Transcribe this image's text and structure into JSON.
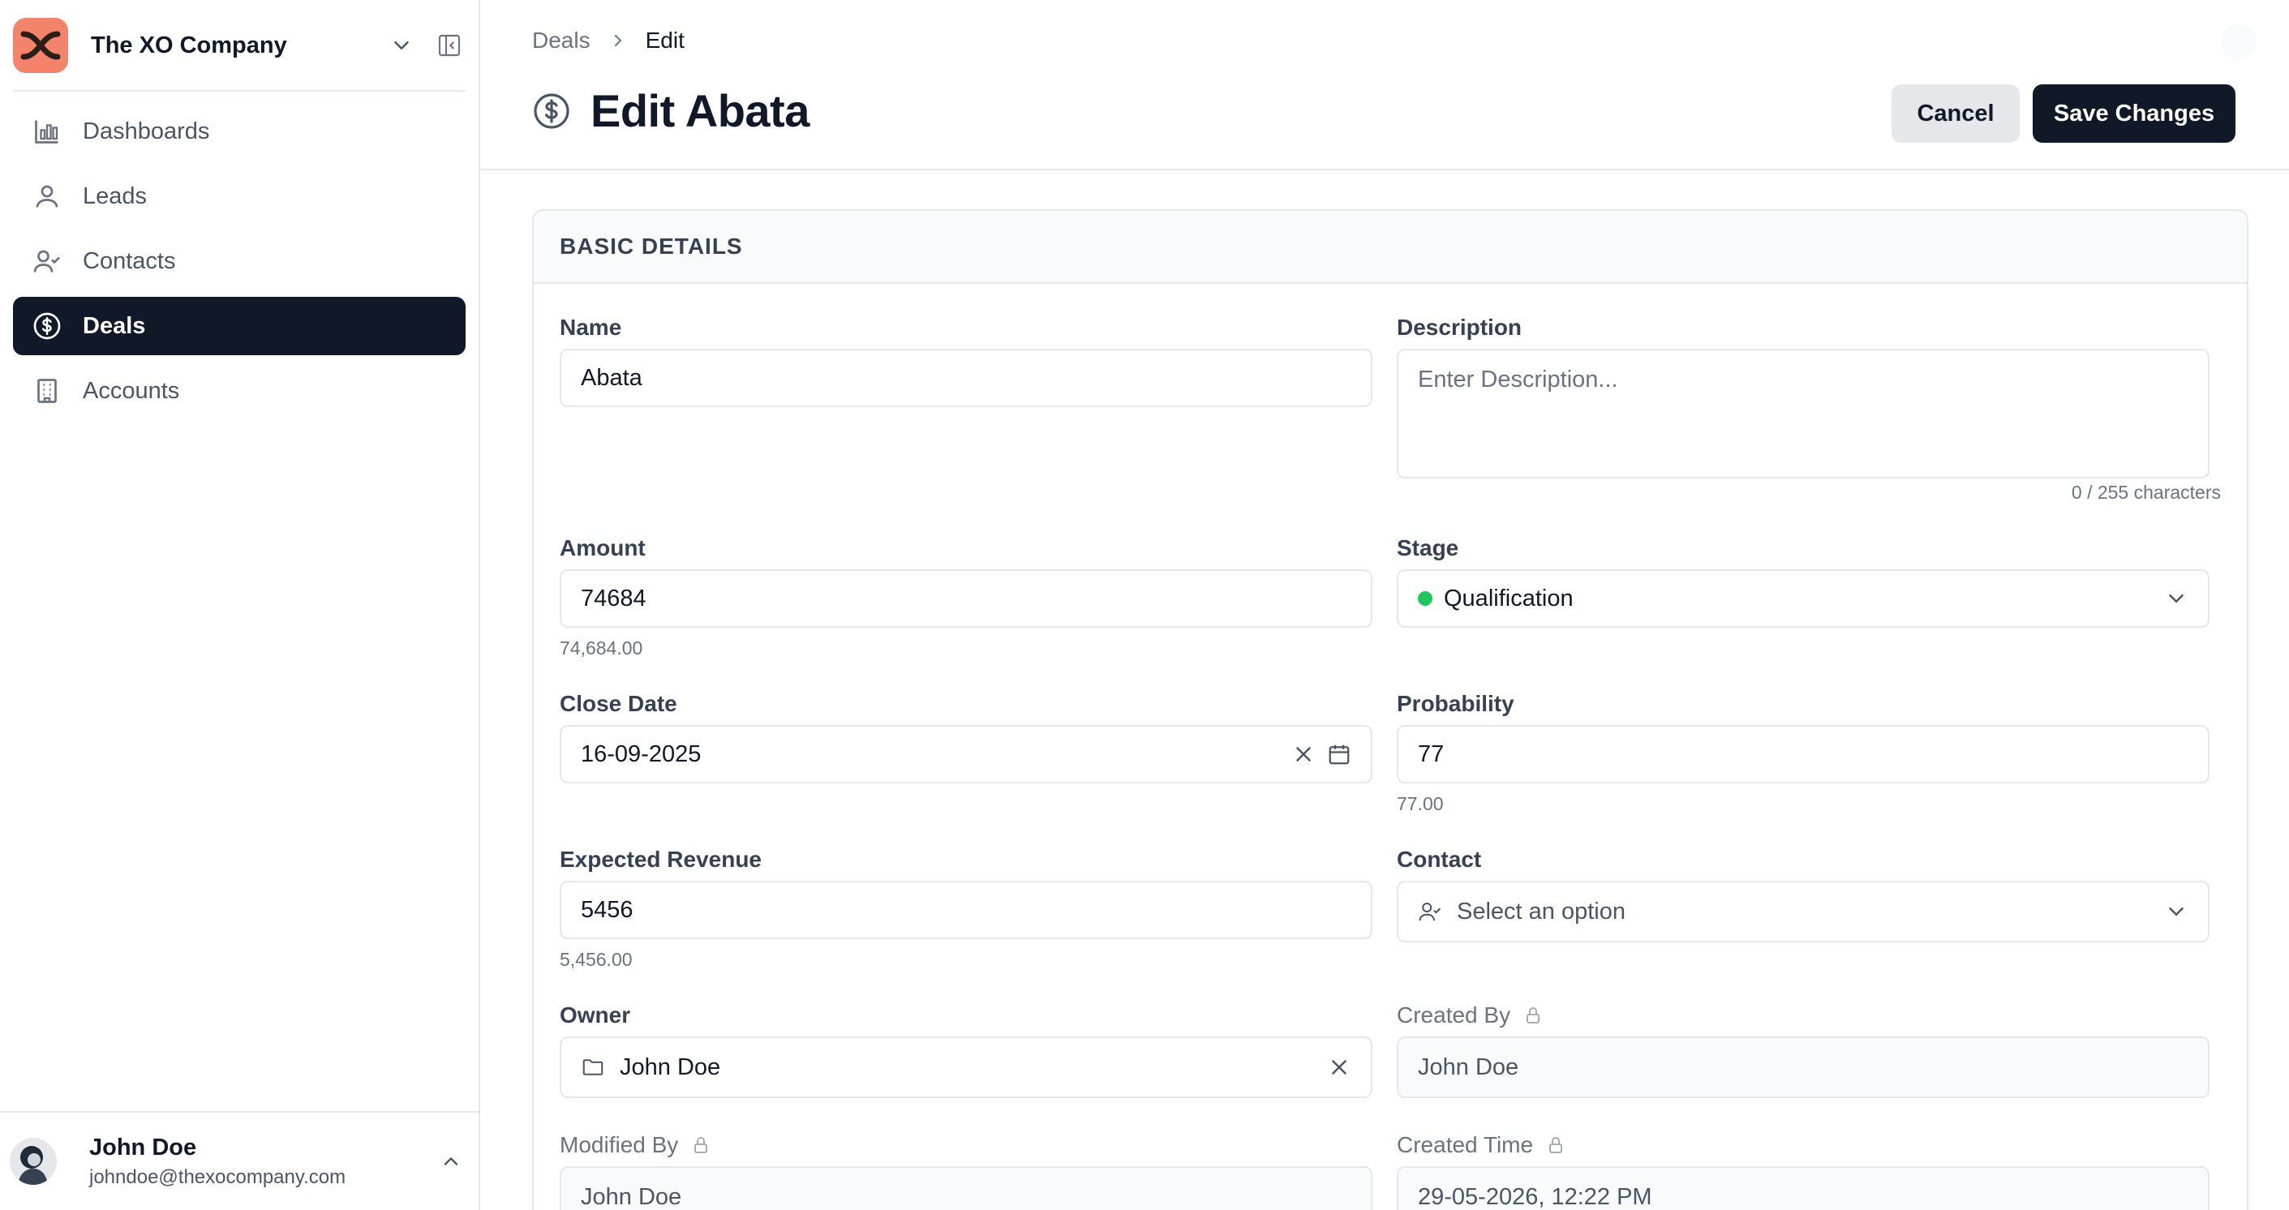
{
  "sidebar": {
    "org_name": "The XO Company",
    "nav": [
      {
        "label": "Dashboards",
        "icon": "bar-chart-icon",
        "active": false
      },
      {
        "label": "Leads",
        "icon": "user-icon",
        "active": false
      },
      {
        "label": "Contacts",
        "icon": "user-check-icon",
        "active": false
      },
      {
        "label": "Deals",
        "icon": "dollar-circle-icon",
        "active": true
      },
      {
        "label": "Accounts",
        "icon": "building-icon",
        "active": false
      }
    ],
    "user": {
      "name": "John Doe",
      "email": "johndoe@thexocompany.com"
    }
  },
  "header": {
    "breadcrumb": {
      "parent": "Deals",
      "current": "Edit"
    },
    "title": "Edit Abata",
    "cancel_label": "Cancel",
    "save_label": "Save Changes"
  },
  "form": {
    "section_title": "BASIC DETAILS",
    "name": {
      "label": "Name",
      "value": "Abata"
    },
    "description": {
      "label": "Description",
      "placeholder": "Enter Description...",
      "counter": "0 / 255 characters"
    },
    "amount": {
      "label": "Amount",
      "value": "74684",
      "formatted": "74,684.00"
    },
    "stage": {
      "label": "Stage",
      "value": "Qualification",
      "color": "#22c55e"
    },
    "close_date": {
      "label": "Close Date",
      "value": "16-09-2025"
    },
    "probability": {
      "label": "Probability",
      "value": "77",
      "formatted": "77.00"
    },
    "expected_revenue": {
      "label": "Expected Revenue",
      "value": "5456",
      "formatted": "5,456.00"
    },
    "contact": {
      "label": "Contact",
      "placeholder": "Select an option"
    },
    "owner": {
      "label": "Owner",
      "value": "John Doe"
    },
    "created_by": {
      "label": "Created By",
      "value": "John Doe"
    },
    "modified_by": {
      "label": "Modified By",
      "value": "John Doe"
    },
    "created_time": {
      "label": "Created Time",
      "value": "29-05-2026, 12:22 PM"
    }
  },
  "colors": {
    "accent": "#111827",
    "border": "#e5e7eb",
    "logo_bg": "#f4836b"
  }
}
